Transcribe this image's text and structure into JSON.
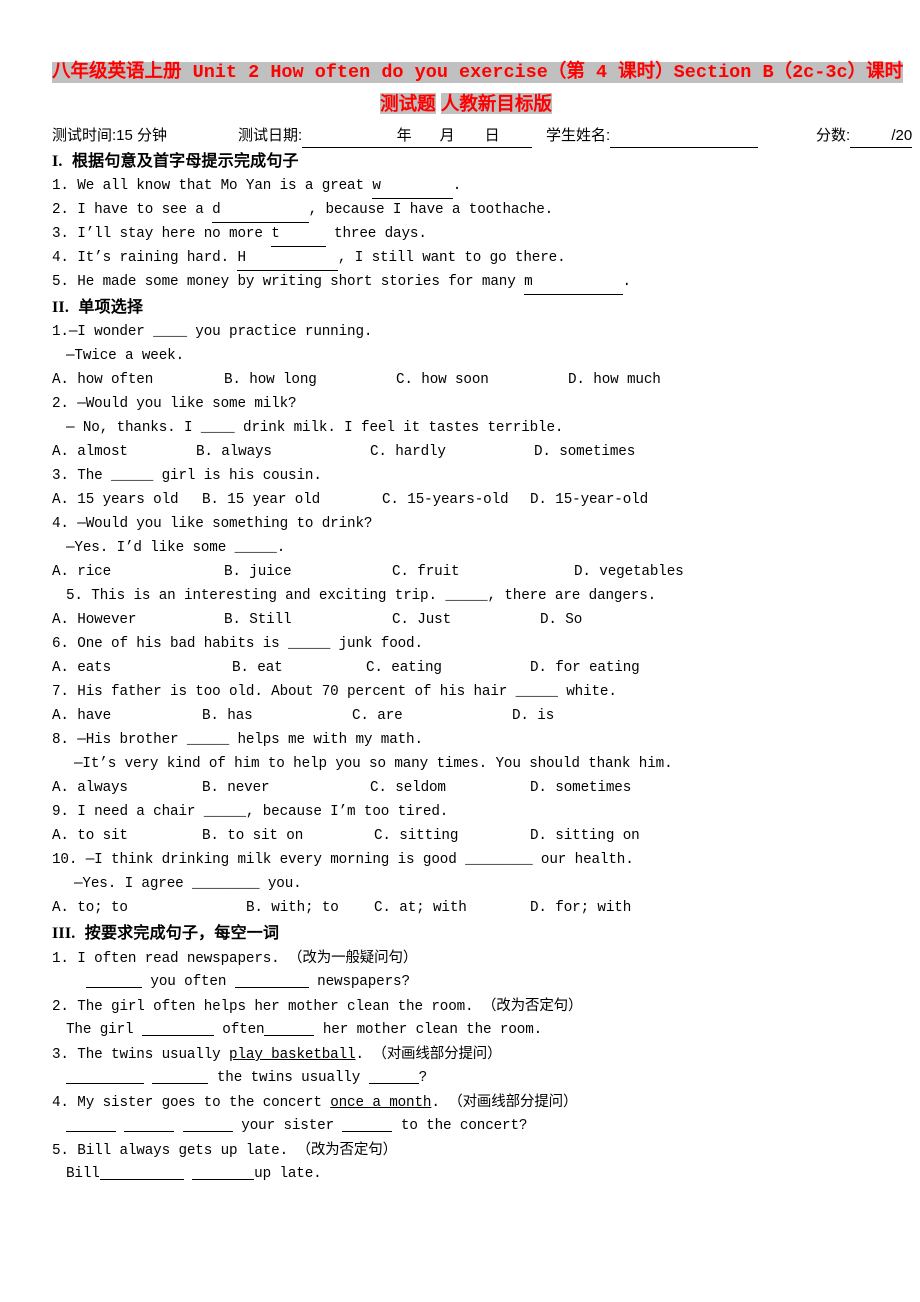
{
  "title": {
    "line1": "八年级英语上册 Unit 2 How often do you exercise（第 4 课时）Section B（2c-3c）课时",
    "line2_a": "测试题",
    "line2_b": "人教新目标版",
    "color": "#ff0000",
    "highlight": "#c0c0c0"
  },
  "meta": {
    "time_label": "测试时间:15 分钟",
    "date_label": "测试日期:",
    "date_year": "年",
    "date_month": "月",
    "date_day": "日",
    "name_label": "学生姓名:",
    "score_label": "分数:",
    "score_total": "/20"
  },
  "section1": {
    "number": "I.",
    "heading": "根据句意及首字母提示完成句子",
    "items": [
      {
        "num": "1.",
        "pre": "We all know that Mo Yan is a great ",
        "hint": "w",
        "post": "."
      },
      {
        "num": "2.",
        "pre": "I have to see a ",
        "hint": "d",
        "post": ", because I have a toothache."
      },
      {
        "num": "3.",
        "pre": "I’ll stay here no more ",
        "hint": "t",
        "post": " three days."
      },
      {
        "num": "4.",
        "pre": "It’s raining hard. ",
        "hint": "H",
        "post": ", I still want to go there."
      },
      {
        "num": "5.",
        "pre": "He made some money by writing short stories for many ",
        "hint": "m",
        "post": "."
      }
    ]
  },
  "section2": {
    "number": "II.",
    "heading": "单项选择",
    "items": [
      {
        "num": "1.",
        "stem": "—I wonder ____ you practice running.",
        "reply": "—Twice a week.",
        "options": [
          "A. how often",
          "B. how long",
          "C. how soon",
          "D. how much"
        ]
      },
      {
        "num": "2.",
        "stem": "—Would you like some milk?",
        "reply": "— No, thanks. I ____ drink milk. I feel it tastes terrible.",
        "options": [
          "A. almost",
          "B. always",
          "C. hardly",
          "D. sometimes"
        ]
      },
      {
        "num": "3.",
        "stem": "The _____ girl is his cousin.",
        "reply": "",
        "options": [
          "A. 15 years old",
          "B. 15 year old",
          "C. 15-years-old",
          "D. 15-year-old"
        ]
      },
      {
        "num": "4.",
        "stem": "—Would you like something to drink?",
        "reply": "—Yes. I’d like some _____.",
        "options": [
          "A. rice",
          "B. juice",
          "C. fruit",
          "D. vegetables"
        ]
      },
      {
        "num": "5.",
        "stem": "This is an interesting and exciting trip. _____, there are dangers.",
        "reply": "",
        "options": [
          "A. However",
          "B. Still",
          "C. Just",
          "D. So"
        ]
      },
      {
        "num": "6.",
        "stem": "One of his bad habits is _____ junk food.",
        "reply": "",
        "options": [
          "A. eats",
          "B. eat",
          "C. eating",
          "D. for eating"
        ]
      },
      {
        "num": "7.",
        "stem": "His father is too old. About 70 percent of his hair _____ white.",
        "reply": "",
        "options": [
          "A. have",
          "B. has",
          "C. are",
          "D. is"
        ]
      },
      {
        "num": "8.",
        "stem": "—His brother _____ helps me with my math.",
        "reply": "—It’s very kind of him to help you so many times. You should thank him.",
        "options": [
          "A. always",
          "B. never",
          "C. seldom",
          "D. sometimes"
        ]
      },
      {
        "num": "9.",
        "stem": "I need a chair _____, because I’m too tired.",
        "reply": "",
        "options": [
          "A. to sit",
          "B. to sit on",
          "C. sitting",
          "D. sitting on"
        ]
      },
      {
        "num": "10.",
        "stem": "—I think drinking milk every morning is good ________ our health.",
        "reply": "—Yes. I agree ________ you.",
        "options": [
          "A. to; to",
          "B. with; to",
          "C. at; with",
          "D. for; with"
        ]
      }
    ]
  },
  "section3": {
    "number": "III.",
    "heading": "按要求完成句子，每空一词",
    "items": [
      {
        "num": "1.",
        "prompt": "I often read newspapers.",
        "instruction": "（改为一般疑问句）",
        "answer_pre": "",
        "answer_mid": " you often ",
        "answer_post": " newspapers?"
      },
      {
        "num": "2.",
        "prompt": "The girl often helps her mother clean the room.",
        "instruction": "（改为否定句）",
        "answer_pre": "The girl ",
        "answer_mid": " often",
        "answer_post": " her mother clean the room."
      },
      {
        "num": "3.",
        "prompt_pre": "The twins usually ",
        "prompt_underlined": "play basketball",
        "prompt_post": ".",
        "instruction": "（对画线部分提问）",
        "answer_mid": " the twins usually ",
        "answer_post": "?"
      },
      {
        "num": "4.",
        "prompt_pre": "My sister goes to the concert ",
        "prompt_underlined": "once a month",
        "prompt_post": ".",
        "instruction": "（对画线部分提问）",
        "answer_mid": " your sister ",
        "answer_post": " to the concert?"
      },
      {
        "num": "5.",
        "prompt": "Bill always gets up late.",
        "instruction": "（改为否定句）",
        "answer_pre": "Bill",
        "answer_post": "up late."
      }
    ]
  }
}
